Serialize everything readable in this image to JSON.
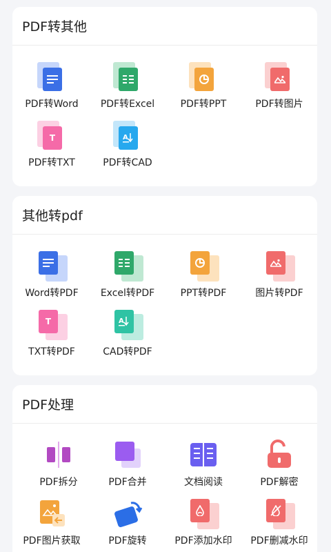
{
  "sections": {
    "pdf_to_other": {
      "title": "PDF转其他",
      "items": [
        "PDF转Word",
        "PDF转Excel",
        "PDF转PPT",
        "PDF转图片",
        "PDF转TXT",
        "PDF转CAD"
      ]
    },
    "other_to_pdf": {
      "title": "其他转pdf",
      "items": [
        "Word转PDF",
        "Excel转PDF",
        "PPT转PDF",
        "图片转PDF",
        "TXT转PDF",
        "CAD转PDF"
      ]
    },
    "pdf_processing": {
      "title": "PDF处理",
      "items": [
        "PDF拆分",
        "PDF合并",
        "文档阅读",
        "PDF解密",
        "PDF图片获取",
        "PDF旋转",
        "PDF添加水印",
        "PDF删减水印"
      ]
    }
  },
  "icons": {
    "word": "word-doc-icon",
    "excel": "excel-sheet-icon",
    "ppt": "ppt-chart-icon",
    "image": "image-icon",
    "txt": "txt-icon",
    "cad": "cad-icon"
  },
  "colors": {
    "word": "#3b6fe6",
    "excel": "#2fa86a",
    "ppt": "#f3a43c",
    "image": "#f06b6b",
    "txt": "#f56aa8",
    "cad": "#27a8ee",
    "purple": "#9b5cf0"
  }
}
